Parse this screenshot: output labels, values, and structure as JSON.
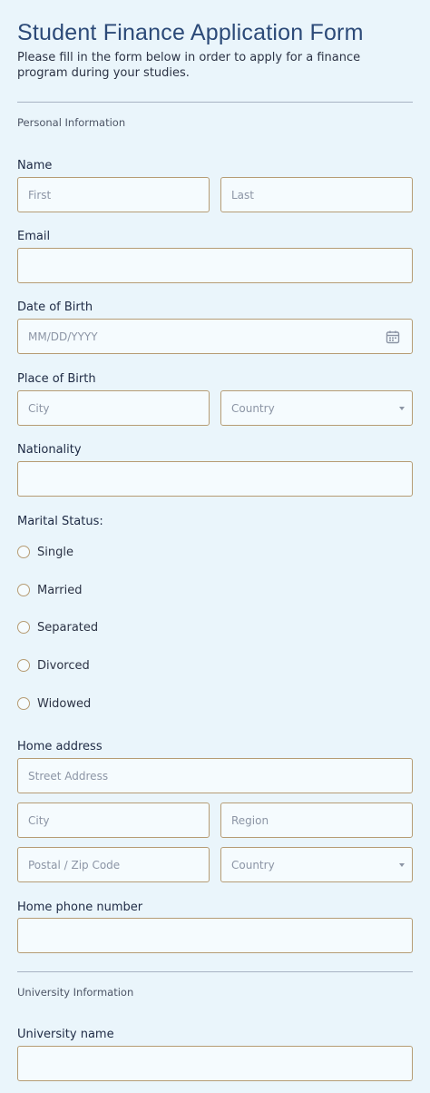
{
  "form": {
    "title": "Student Finance Application Form",
    "subtitle": "Please fill in the form below in order to apply for a finance program during your studies."
  },
  "sections": {
    "personal": "Personal Information",
    "university": "University Information"
  },
  "fields": {
    "name": {
      "label": "Name",
      "first_placeholder": "First",
      "last_placeholder": "Last"
    },
    "email": {
      "label": "Email"
    },
    "dob": {
      "label": "Date of Birth",
      "placeholder": "MM/DD/YYYY"
    },
    "place_of_birth": {
      "label": "Place of Birth",
      "city_placeholder": "City",
      "country_placeholder": "Country"
    },
    "nationality": {
      "label": "Nationality"
    },
    "marital": {
      "label": "Marital Status:",
      "options": [
        "Single",
        "Married",
        "Separated",
        "Divorced",
        "Widowed"
      ]
    },
    "home_address": {
      "label": "Home address",
      "street_placeholder": "Street Address",
      "city_placeholder": "City",
      "region_placeholder": "Region",
      "postal_placeholder": "Postal / Zip Code",
      "country_placeholder": "Country"
    },
    "home_phone": {
      "label": "Home phone number"
    },
    "university_name": {
      "label": "University name"
    }
  },
  "icons": {
    "calendar": "calendar-icon",
    "dropdown": "chevron-down-icon"
  },
  "colors": {
    "background": "#eaf5fb",
    "field_border": "#b69c74",
    "title": "#2c4a78"
  }
}
